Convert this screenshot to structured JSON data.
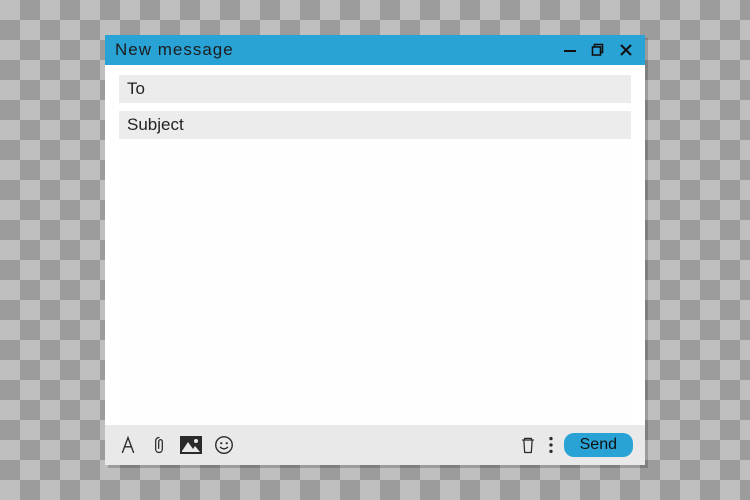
{
  "window": {
    "title": "New  message"
  },
  "fields": {
    "to_label": "To",
    "to_value": "",
    "subject_label": "Subject",
    "subject_value": "",
    "body_value": ""
  },
  "toolbar": {
    "send_label": "Send"
  },
  "colors": {
    "accent": "#29a3d6"
  }
}
